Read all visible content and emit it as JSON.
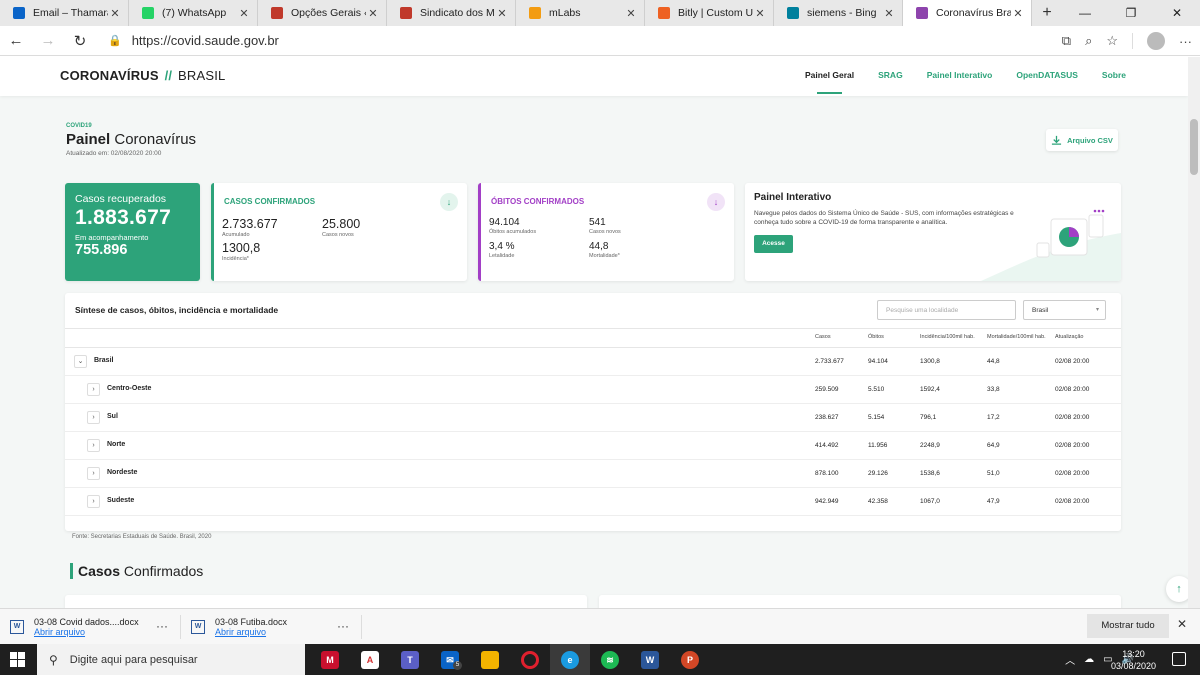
{
  "browser": {
    "tabs": [
      {
        "label": "Email – Thamara M",
        "icon": "outlook-icon",
        "color": "#0a64c8"
      },
      {
        "label": "(7) WhatsApp",
        "icon": "whatsapp-icon",
        "color": "#25d366"
      },
      {
        "label": "Opções Gerais ‹ Si",
        "icon": "sindicato-icon",
        "color": "#c0392b"
      },
      {
        "label": "Sindicato dos Met",
        "icon": "sindicato-icon",
        "color": "#c0392b"
      },
      {
        "label": "mLabs",
        "icon": "mlabs-icon",
        "color": "#f39c12"
      },
      {
        "label": "Bitly | Custom URL",
        "icon": "bitly-icon",
        "color": "#ee6123"
      },
      {
        "label": "siemens - Bing",
        "icon": "bing-icon",
        "color": "#00809d"
      },
      {
        "label": "Coronavírus Brasil",
        "icon": "covid-icon",
        "color": "#8e44ad"
      }
    ],
    "url": "https://covid.saude.gov.br"
  },
  "site": {
    "brand_bold": "CORONAVÍRUS",
    "brand_slash": "//",
    "brand_light": "BRASIL",
    "nav": [
      "Painel Geral",
      "SRAG",
      "Painel Interativo",
      "OpenDATASUS",
      "Sobre"
    ]
  },
  "panel": {
    "kicker": "COVID19",
    "title_bold": "Painel",
    "title_rest": "Coronavírus",
    "updated": "Atualizado em: 02/08/2020 20:00",
    "csv_label": "Arquivo CSV"
  },
  "cards": {
    "recovered": {
      "label": "Casos recuperados",
      "value": "1.883.677",
      "sub_label": "Em acompanhamento",
      "sub_value": "755.896"
    },
    "confirmed": {
      "title": "CASOS CONFIRMADOS",
      "accumulated": "2.733.677",
      "accumulated_label": "Acumulado",
      "new": "25.800",
      "new_label": "Casos novos",
      "incidence": "1300,8",
      "incidence_label": "Incidência*"
    },
    "deaths": {
      "title": "ÓBITOS CONFIRMADOS",
      "accumulated": "94.104",
      "accumulated_label": "Óbitos acumulados",
      "new": "541",
      "new_label": "Casos novos",
      "lethality": "3,4 %",
      "lethality_label": "Letalidade",
      "mortality": "44,8",
      "mortality_label": "Mortalidade*"
    },
    "interactive": {
      "title": "Painel Interativo",
      "desc": "Navegue pelos dados do Sistema Único de Saúde - SUS, com informações estratégicas e conheça tudo sobre a COVID-19 de forma transparente e analítica.",
      "button": "Acesse"
    }
  },
  "table": {
    "title": "Síntese de casos, óbitos, incidência e mortalidade",
    "search_placeholder": "Pesquise uma localidade",
    "select_value": "Brasil",
    "headers": [
      "Casos",
      "Óbitos",
      "Incidência/100mil hab.",
      "Mortalidade/100mil hab.",
      "Atualização"
    ],
    "rows": [
      {
        "name": "Brasil",
        "cases": "2.733.677",
        "deaths": "94.104",
        "incidence": "1300,8",
        "mortality": "44,8",
        "updated": "02/08 20:00",
        "toggle": "⌄",
        "level": 0
      },
      {
        "name": "Centro-Oeste",
        "cases": "259.509",
        "deaths": "5.510",
        "incidence": "1592,4",
        "mortality": "33,8",
        "updated": "02/08 20:00",
        "toggle": "›",
        "level": 1
      },
      {
        "name": "Sul",
        "cases": "238.627",
        "deaths": "5.154",
        "incidence": "796,1",
        "mortality": "17,2",
        "updated": "02/08 20:00",
        "toggle": "›",
        "level": 1
      },
      {
        "name": "Norte",
        "cases": "414.492",
        "deaths": "11.956",
        "incidence": "2248,9",
        "mortality": "64,9",
        "updated": "02/08 20:00",
        "toggle": "›",
        "level": 1
      },
      {
        "name": "Nordeste",
        "cases": "878.100",
        "deaths": "29.126",
        "incidence": "1538,6",
        "mortality": "51,0",
        "updated": "02/08 20:00",
        "toggle": "›",
        "level": 1
      },
      {
        "name": "Sudeste",
        "cases": "942.949",
        "deaths": "42.358",
        "incidence": "1067,0",
        "mortality": "47,9",
        "updated": "02/08 20:00",
        "toggle": "›",
        "level": 1
      }
    ],
    "source": "Fonte: Secretarias Estaduais de Saúde. Brasil, 2020"
  },
  "section": {
    "title_bold": "Casos",
    "title_rest": "Confirmados"
  },
  "downloads": {
    "items": [
      {
        "name": "03-08 Covid dados....docx",
        "action": "Abrir arquivo"
      },
      {
        "name": "03-08 Futiba.docx",
        "action": "Abrir arquivo"
      }
    ],
    "show_all": "Mostrar tudo"
  },
  "taskbar": {
    "search_placeholder": "Digite aqui para pesquisar",
    "mail_badge": "5",
    "time": "13:20",
    "date": "03/08/2020"
  },
  "colors": {
    "brand_green": "#2da37a",
    "deaths_purple": "#a23fc6"
  }
}
